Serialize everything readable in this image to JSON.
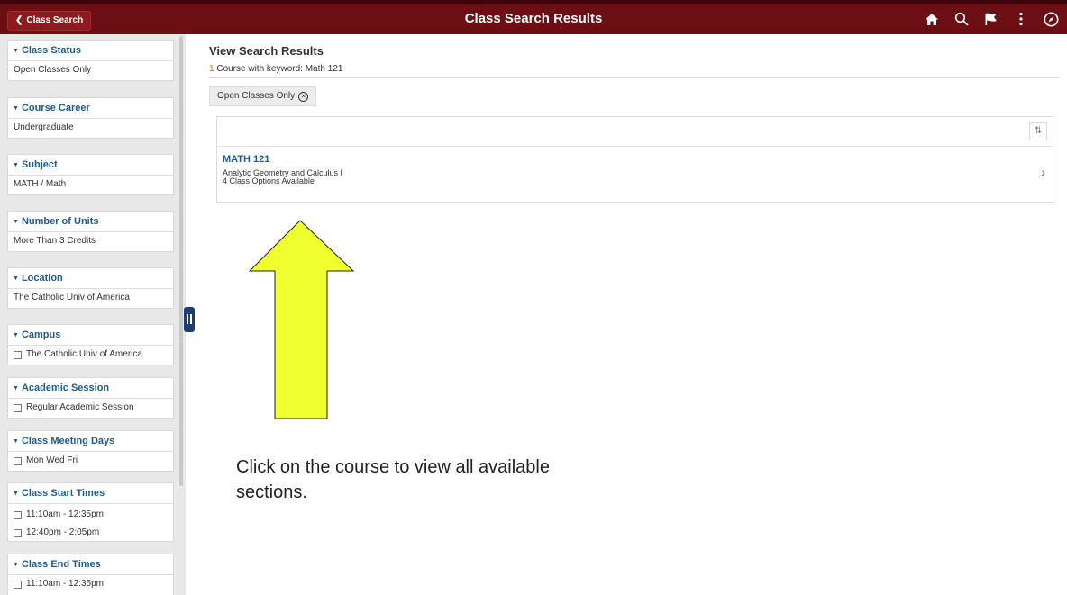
{
  "header": {
    "back_label": "Class Search",
    "title": "Class Search Results",
    "icons": [
      "home-icon",
      "search-icon",
      "flag-icon",
      "more-icon",
      "compass-icon"
    ]
  },
  "sidebar": {
    "facets": [
      {
        "title": "Class Status",
        "value": "Open Classes Only"
      },
      {
        "title": "Course Career",
        "value": "Undergraduate"
      },
      {
        "title": "Subject",
        "value": "MATH / Math"
      },
      {
        "title": "Number of Units",
        "value": "More Than 3 Credits"
      },
      {
        "title": "Location",
        "value": "The Catholic Univ of America"
      },
      {
        "title": "Campus",
        "options": [
          "The Catholic Univ of America"
        ]
      },
      {
        "title": "Academic Session",
        "options": [
          "Regular Academic Session"
        ]
      },
      {
        "title": "Class Meeting Days",
        "options": [
          "Mon Wed Fri"
        ]
      },
      {
        "title": "Class Start Times",
        "options": [
          "11:10am - 12:35pm",
          "12:40pm - 2:05pm"
        ]
      },
      {
        "title": "Class End Times",
        "options": [
          "11:10am - 12:35pm"
        ]
      }
    ]
  },
  "main": {
    "title": "View Search Results",
    "result_count": "1",
    "result_text": " Course with keyword: Math 121",
    "filter_pill": "Open Classes Only",
    "course": {
      "code": "MATH 121",
      "name": "Analytic Geometry and Calculus I",
      "options": "4 Class Options Available"
    }
  },
  "annotation": {
    "text": "Click on the course to view all available sections.",
    "arrow_color": "#f0ff2e"
  },
  "colors": {
    "header_bg": "#6b0f15",
    "link_blue": "#1f5b8e",
    "count_orange": "#c97b00"
  }
}
